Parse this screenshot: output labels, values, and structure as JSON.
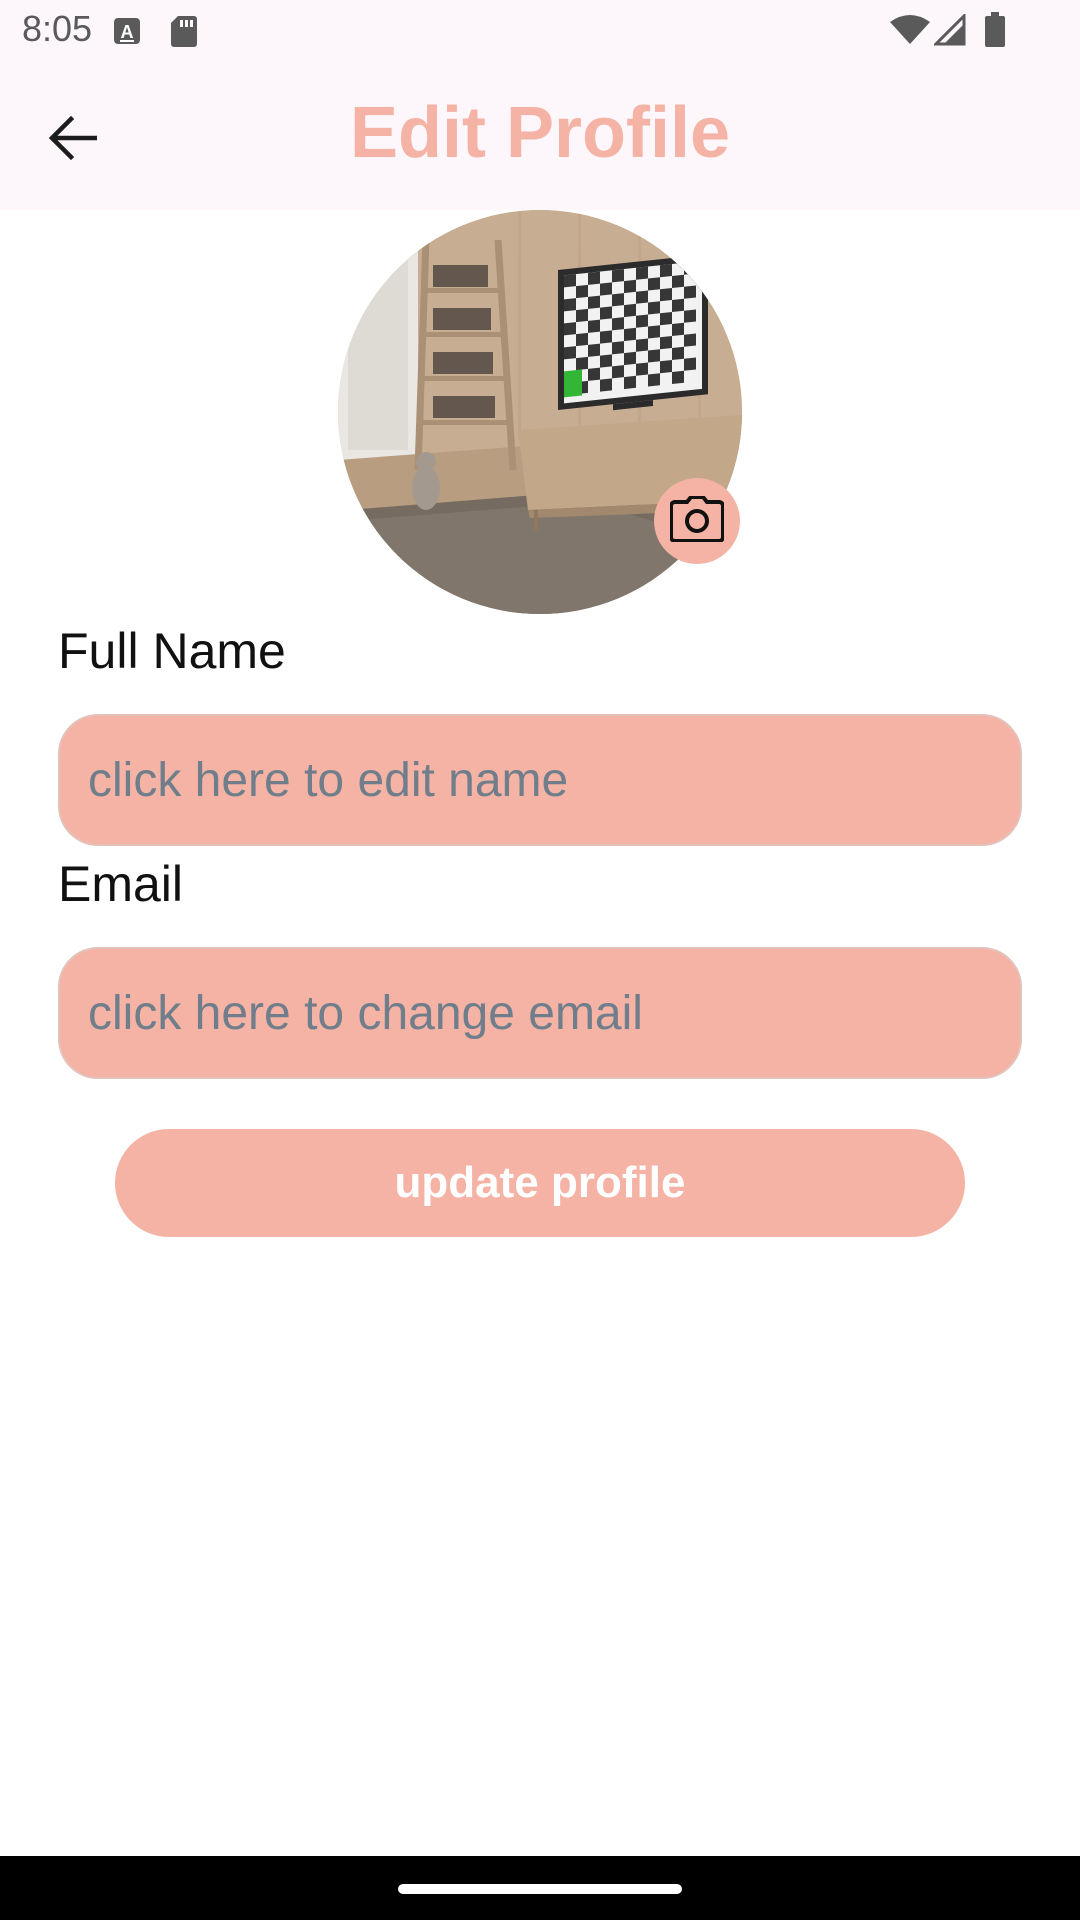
{
  "status_bar": {
    "time": "8:05",
    "icons": [
      "keyboard-a-icon",
      "sd-card-icon",
      "wifi-icon",
      "signal-icon",
      "battery-icon"
    ]
  },
  "app_bar": {
    "title": "Edit Profile",
    "back_icon": "arrow-back-icon"
  },
  "avatar": {
    "description_icon": "profile-photo",
    "camera_icon": "camera-icon"
  },
  "form": {
    "name_label": "Full Name",
    "name_placeholder": "click here to edit name",
    "name_value": "",
    "email_label": "Email",
    "email_placeholder": "click here to change email",
    "email_value": ""
  },
  "update_button": {
    "label": "update profile"
  },
  "colors": {
    "accent": "#f4b3a4",
    "app_bar_bg": "#fdf6fb",
    "placeholder": "#6f7e8a"
  }
}
